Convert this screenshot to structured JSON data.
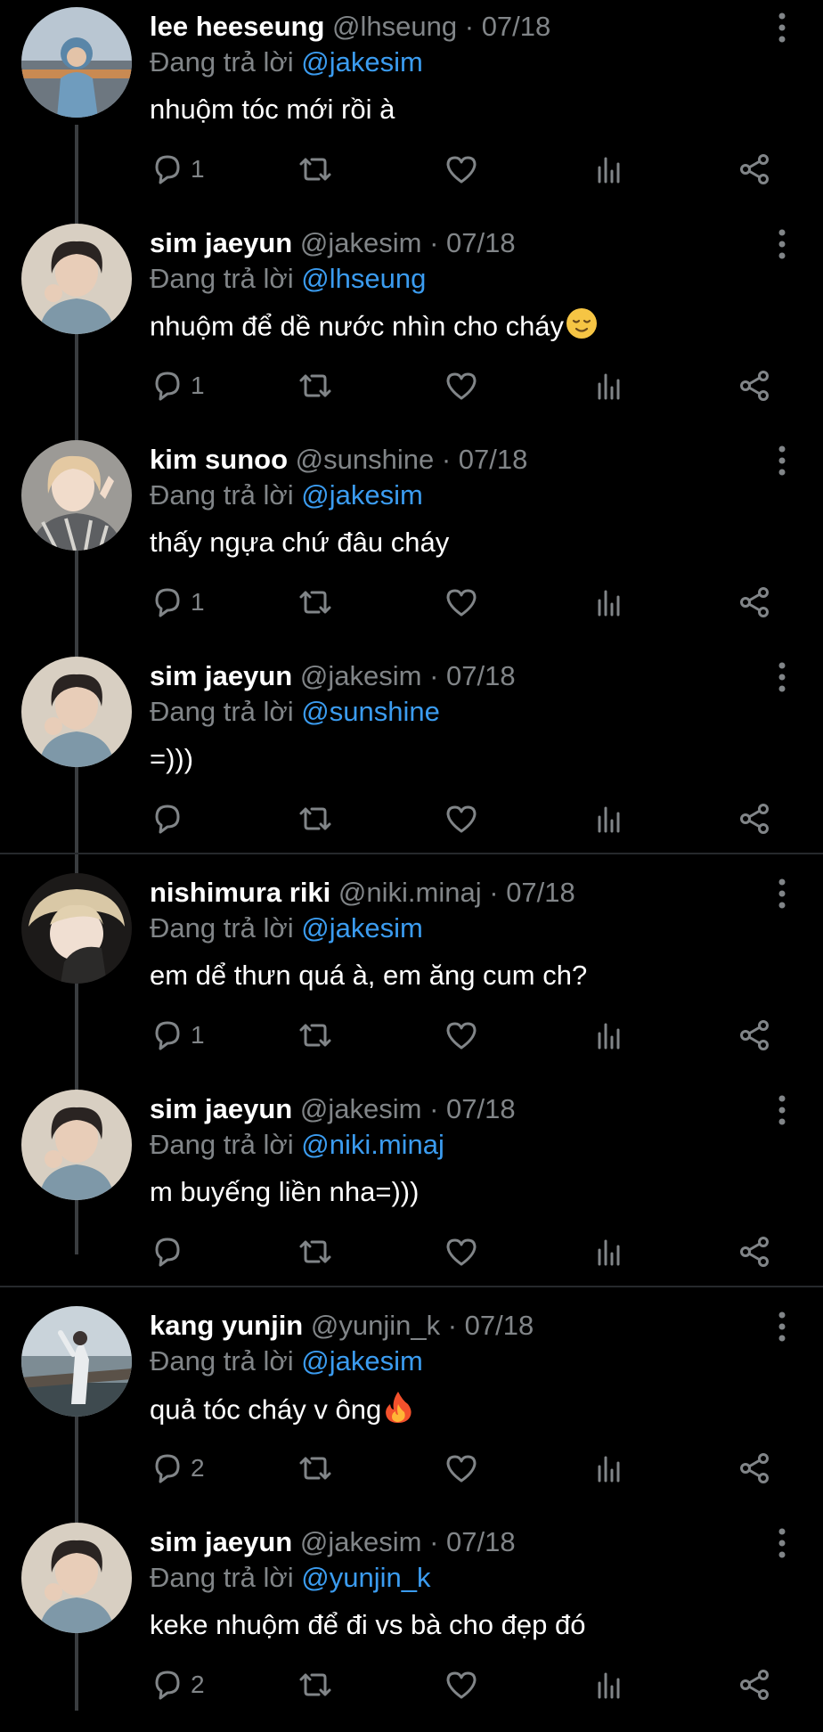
{
  "reply_prefix": "Đang trả lời",
  "colors": {
    "background": "#000000",
    "name": "#ffffff",
    "secondary_text": "#818588",
    "mention": "#3b9cf0",
    "icon": "#818588"
  },
  "icons": {
    "reply": "speech-bubble",
    "retweet": "retweet-arrows",
    "like": "heart",
    "views": "bar-chart",
    "share": "share-nodes",
    "more": "vertical-dots"
  },
  "tweets": [
    {
      "name": "lee heeseung",
      "handle": "@lhseung",
      "separator": "·",
      "date": "07/18",
      "reply_to": "@jakesim",
      "text": "nhuộm tóc mới rồi à",
      "emoji": "",
      "reply_count": "1"
    },
    {
      "name": "sim jaeyun",
      "handle": "@jakesim",
      "separator": "·",
      "date": "07/18",
      "reply_to": "@lhseung",
      "text": "nhuộm để dề nước nhìn cho cháy",
      "emoji": "relieved-face",
      "reply_count": "1"
    },
    {
      "name": "kim sunoo",
      "handle": "@sunshine",
      "separator": "·",
      "date": "07/18",
      "reply_to": "@jakesim",
      "text": "thấy ngựa chứ đâu cháy",
      "emoji": "",
      "reply_count": "1"
    },
    {
      "name": "sim jaeyun",
      "handle": "@jakesim",
      "separator": "·",
      "date": "07/18",
      "reply_to": "@sunshine",
      "text": "=)))",
      "emoji": "",
      "reply_count": ""
    },
    {
      "name": "nishimura riki",
      "handle": "@niki.minaj",
      "separator": "·",
      "date": "07/18",
      "reply_to": "@jakesim",
      "text": "em dể thưn quá à, em ăng cum ch?",
      "emoji": "",
      "reply_count": "1"
    },
    {
      "name": "sim jaeyun",
      "handle": "@jakesim",
      "separator": "·",
      "date": "07/18",
      "reply_to": "@niki.minaj",
      "text": "m buyếng liền nha=)))",
      "emoji": "",
      "reply_count": ""
    },
    {
      "name": "kang yunjin",
      "handle": "@yunjin_k",
      "separator": "·",
      "date": "07/18",
      "reply_to": "@jakesim",
      "text": "quả tóc cháy v ông",
      "emoji": "fire",
      "reply_count": "2"
    },
    {
      "name": "sim jaeyun",
      "handle": "@jakesim",
      "separator": "·",
      "date": "07/18",
      "reply_to": "@yunjin_k",
      "text": "keke nhuộm để đi vs bà cho đẹp đó",
      "emoji": "",
      "reply_count": "2"
    }
  ]
}
